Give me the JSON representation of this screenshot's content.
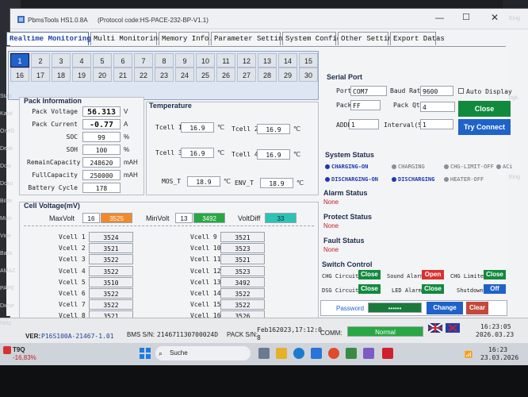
{
  "desktop_left": [
    "Start",
    "Katal",
    "OneD",
    "Desk",
    "Dow",
    "Doku",
    "Bilde",
    "Musi",
    "Vide",
    "Back",
    "AMAZ",
    "PAPE",
    "Diese",
    "Netz"
  ],
  "desktop_right": [
    "Eing",
    "bgk.",
    "Eing"
  ],
  "window": {
    "app_title": "PbmsTools HS1.0.8A",
    "protocol": "(Protocol code:HS-PACE-232-BP-V1.1)"
  },
  "tabs": [
    "Realtime Monitoring",
    "Multi Monitoring",
    "Memory Info.",
    "Parameter Setting",
    "System Config.",
    "Other Setting",
    "Export Datas"
  ],
  "cells_row1": [
    "1",
    "2",
    "3",
    "4",
    "5",
    "6",
    "7",
    "8",
    "9",
    "10",
    "11",
    "12",
    "13",
    "14",
    "15"
  ],
  "cells_row2": [
    "16",
    "17",
    "18",
    "19",
    "20",
    "21",
    "22",
    "23",
    "24",
    "25",
    "26",
    "27",
    "28",
    "29",
    "30"
  ],
  "pack_info": {
    "title": "Pack Information",
    "rows": [
      {
        "label": "Pack Voltage",
        "value": "56.313",
        "unit": "V"
      },
      {
        "label": "Pack Current",
        "value": "-0.77",
        "unit": "A"
      },
      {
        "label": "SOC",
        "value": "99",
        "unit": "%"
      },
      {
        "label": "SOH",
        "value": "100",
        "unit": "%"
      },
      {
        "label": "RemainCapacity",
        "value": "248620",
        "unit": "mAH"
      },
      {
        "label": "FullCapacity",
        "value": "250000",
        "unit": "mAH"
      },
      {
        "label": "Battery Cycle",
        "value": "178",
        "unit": ""
      }
    ]
  },
  "temperature": {
    "title": "Temperature",
    "unit": "℃",
    "rows": [
      {
        "label": "Tcell 1",
        "value": "16.9"
      },
      {
        "label": "Tcell 2",
        "value": "16.9"
      },
      {
        "label": "Tcell 3",
        "value": "16.9"
      },
      {
        "label": "Tcell 4",
        "value": "16.9"
      },
      {
        "label": "MOS_T",
        "value": "18.9"
      },
      {
        "label": "ENV_T",
        "value": "18.9"
      }
    ]
  },
  "cell_voltage": {
    "title": "Cell Voltage(mV)",
    "max_label": "MaxVolt",
    "max_cell": "16",
    "max_value": "3525",
    "min_label": "MinVolt",
    "min_cell": "13",
    "min_value": "3492",
    "diff_label": "VoltDiff",
    "diff_value": "33",
    "left": [
      {
        "label": "Vcell 1",
        "value": "3524"
      },
      {
        "label": "Vcell 2",
        "value": "3521"
      },
      {
        "label": "Vcell 3",
        "value": "3522"
      },
      {
        "label": "Vcell 4",
        "value": "3522"
      },
      {
        "label": "Vcell 5",
        "value": "3510"
      },
      {
        "label": "Vcell 6",
        "value": "3522"
      },
      {
        "label": "Vcell 7",
        "value": "3522"
      },
      {
        "label": "Vcell 8",
        "value": "3521"
      }
    ],
    "right": [
      {
        "label": "Vcell 9",
        "value": "3521"
      },
      {
        "label": "Vcell 10",
        "value": "3523"
      },
      {
        "label": "Vcell 11",
        "value": "3521"
      },
      {
        "label": "Vcell 12",
        "value": "3523"
      },
      {
        "label": "Vcell 13",
        "value": "3492"
      },
      {
        "label": "Vcell 14",
        "value": "3522"
      },
      {
        "label": "Vcell 15",
        "value": "3522"
      },
      {
        "label": "Vcell 16",
        "value": "3526"
      }
    ]
  },
  "serial": {
    "title": "Serial Port",
    "port_label": "Port",
    "port_value": "COM7",
    "baud_label": "Baud Rate",
    "baud_value": "9600",
    "auto_label": "Auto Display",
    "pack_label": "Pack",
    "pack_value": "FF",
    "qty_label": "Pack Qty",
    "qty_value": "4",
    "addr_label": "ADDR",
    "addr_value": "1",
    "interval_label": "Interval(S)",
    "interval_value": "1",
    "close_label": "Close",
    "connect_label": "Try Connect"
  },
  "system_status": {
    "title": "System Status",
    "items": [
      {
        "label": "CHARGING-ON",
        "on": true
      },
      {
        "label": "CHARGING",
        "on": false
      },
      {
        "label": "CHG-LIMIT-OFF",
        "on": false
      },
      {
        "label": "ACi",
        "on": false
      },
      {
        "label": "DISCHARGING-ON",
        "on": true
      },
      {
        "label": "DISCHARGING",
        "on": true
      },
      {
        "label": "HEATER-OFF",
        "on": false
      }
    ]
  },
  "alarm": {
    "title": "Alarm Status",
    "value": "None"
  },
  "protect": {
    "title": "Protect Status",
    "value": "None"
  },
  "fault": {
    "title": "Fault Status",
    "value": "None"
  },
  "switch": {
    "title": "Switch Control",
    "chg_label": "CHG Circuit",
    "chg_btn": "Close",
    "sound_label": "Sound Alarm",
    "sound_btn": "Open",
    "limiter_label": "CHG Limiter",
    "limiter_btn": "Close",
    "dsg_label": "DSG Circuit",
    "dsg_btn": "Close",
    "led_label": "LED Alarm",
    "led_btn": "Close",
    "shutdown_label": "Shutdown",
    "shutdown_btn": "Off"
  },
  "password": {
    "label": "Password",
    "value": "••••••",
    "change": "Change",
    "clear": "Clear"
  },
  "statusbar": {
    "ver_label": "VER:",
    "ver_value": "P16S100A-21467-1.01",
    "bms_label": "BMS S/N:",
    "bms_value": "214671130700024D",
    "pack_label": "PACK S/N:",
    "pack_value_1": "Feb162023,17:12:0",
    "pack_value_2": "8",
    "comm_label": "COMM:",
    "comm_value": "Normal",
    "time": "16:23:05",
    "date": "2026.03.23"
  },
  "taskbar": {
    "stock_name": "T9Q",
    "stock_change": "-16,83%",
    "search_placeholder": "Suche",
    "time": "16:23",
    "date": "23.03.2026"
  },
  "colors": {
    "accent": "#1f62c9",
    "orange": "#f08a2a",
    "green": "#27a842",
    "teal": "#2bc4b2",
    "red": "#d8322f"
  }
}
